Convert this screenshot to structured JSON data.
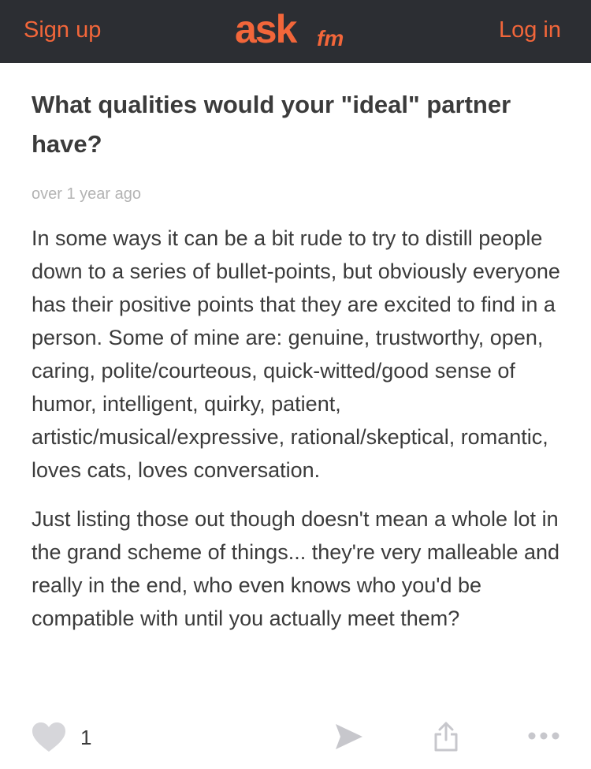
{
  "header": {
    "signup_label": "Sign up",
    "login_label": "Log in",
    "logo_text": "ask",
    "logo_suffix": "fm",
    "accent_color": "#f2663a",
    "background_color": "#2c2e33"
  },
  "post": {
    "question": "What qualities would your \"ideal\" partner have?",
    "timestamp": "over 1 year ago",
    "answer_paragraphs": [
      "In some ways it can be a bit rude to try to distill people down to a series of bullet-points, but obviously everyone has their positive points that they are excited to find in a person. Some of mine are: genuine, trustworthy, open, caring, polite/courteous, quick-witted/good sense of humor, intelligent, quirky, patient, artistic/musical/expressive, rational/skeptical, romantic, loves cats, loves conversation.",
      "Just listing those out though doesn't mean a whole lot in the grand scheme of things... they're very malleable and really in the end, who even knows who you'd be compatible with until you actually meet them?"
    ]
  },
  "actions": {
    "like_count": "1",
    "icons": [
      "heart-icon",
      "send-icon",
      "share-icon",
      "more-icon"
    ]
  }
}
